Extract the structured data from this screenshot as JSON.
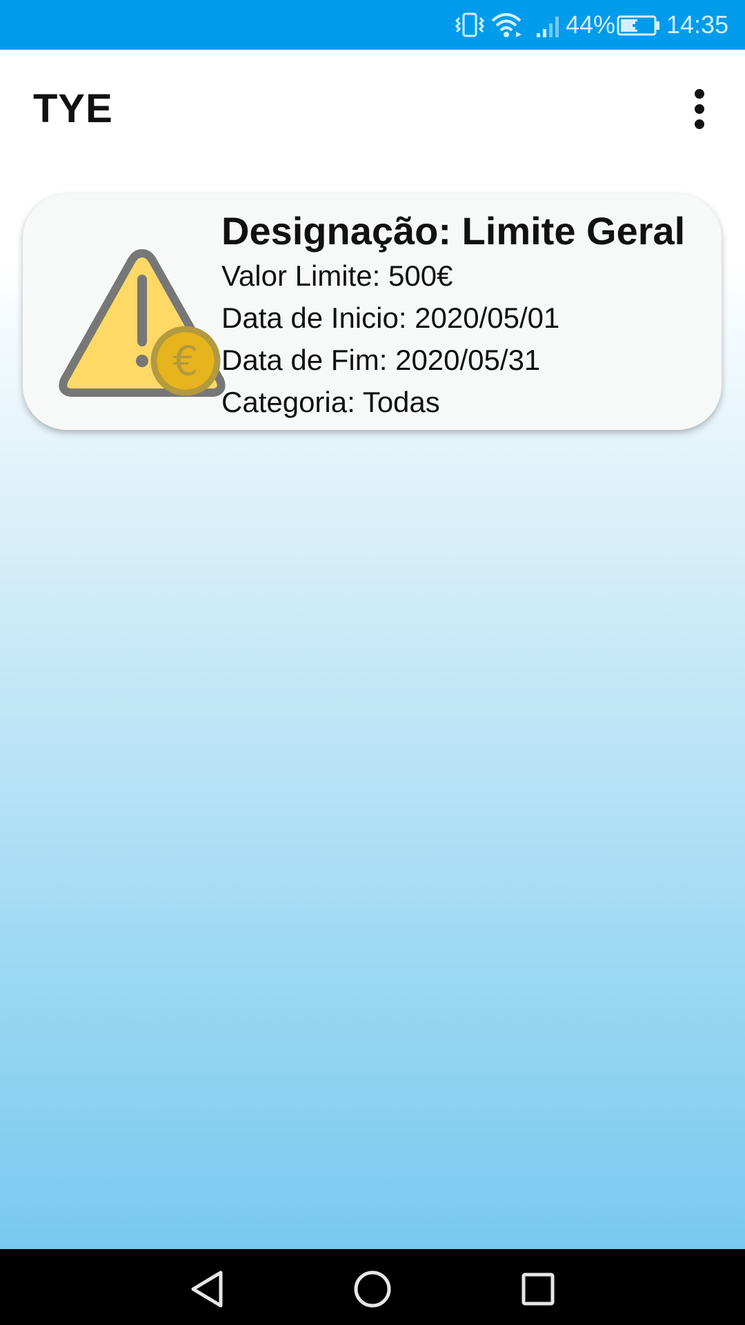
{
  "status_bar": {
    "battery": "44%",
    "time": "14:35",
    "icons": [
      "vibrate-icon",
      "wifi-icon",
      "signal-icon",
      "battery-charging-icon"
    ]
  },
  "app_bar": {
    "title": "TYE",
    "menu_icon": "more-vert-icon"
  },
  "limit_card": {
    "icon": "warning-euro-icon",
    "designation": "Designação: Limite Geral",
    "limit_value": "Valor Limite: 500€",
    "start_date": "Data de Inicio: 2020/05/01",
    "end_date": "Data de Fim: 2020/05/31",
    "category": "Categoria: Todas"
  },
  "nav_bar": {
    "icons": [
      "back-icon",
      "home-icon",
      "recents-icon"
    ]
  },
  "colors": {
    "status_bar": "#009ceb",
    "warning_fill": "#ffd966",
    "warning_stroke": "#777777",
    "coin_fill": "#e6b41c",
    "coin_ring": "#b39a3f"
  }
}
